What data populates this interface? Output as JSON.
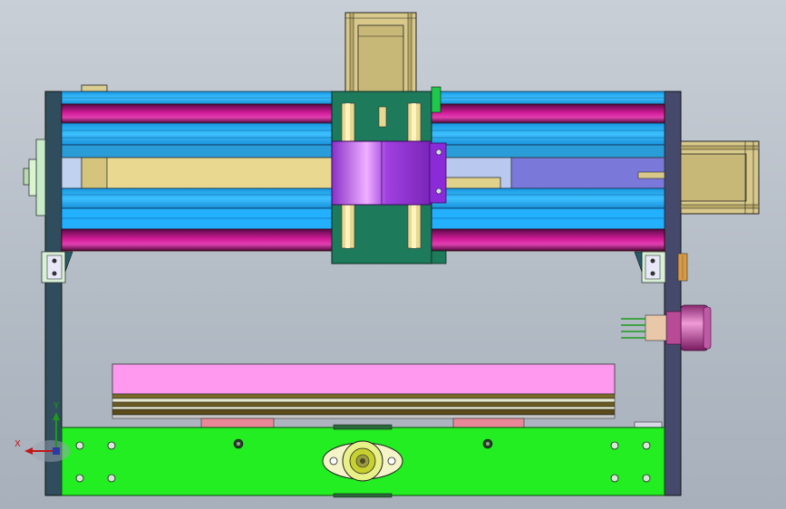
{
  "viewport": {
    "background_top": "#c9cfd6",
    "background_bottom": "#a7b0bb"
  },
  "triad": {
    "x_label": "X",
    "y_label": "Y",
    "x_color": "#c01818",
    "y_color": "#1b9a1b"
  },
  "parts": [
    {
      "name": "side-frame-left",
      "color": "#2f4d5c"
    },
    {
      "name": "side-frame-right",
      "color": "#454a6c"
    },
    {
      "name": "rail-upper",
      "color": "#20b0ff"
    },
    {
      "name": "rail-lower",
      "color": "#20b0ff"
    },
    {
      "name": "guide-rod-magenta",
      "color": "#c0168c"
    },
    {
      "name": "lead-screw-tan",
      "color": "#e8d890"
    },
    {
      "name": "motor-top",
      "color": "#d8c88a"
    },
    {
      "name": "motor-right",
      "color": "#d8c88a"
    },
    {
      "name": "carriage-green",
      "color": "#1d7a5a"
    },
    {
      "name": "spindle-clamp-purple",
      "color": "#b04ae8"
    },
    {
      "name": "bed-pink",
      "color": "#ff99f0"
    },
    {
      "name": "bed-layers-brown",
      "color": "#6a5a22"
    },
    {
      "name": "base-plate-green",
      "color": "#22ee22"
    },
    {
      "name": "power-socket-pink",
      "color": "#d868b8"
    },
    {
      "name": "flange-bearing",
      "color": "#f4f4c8"
    }
  ]
}
